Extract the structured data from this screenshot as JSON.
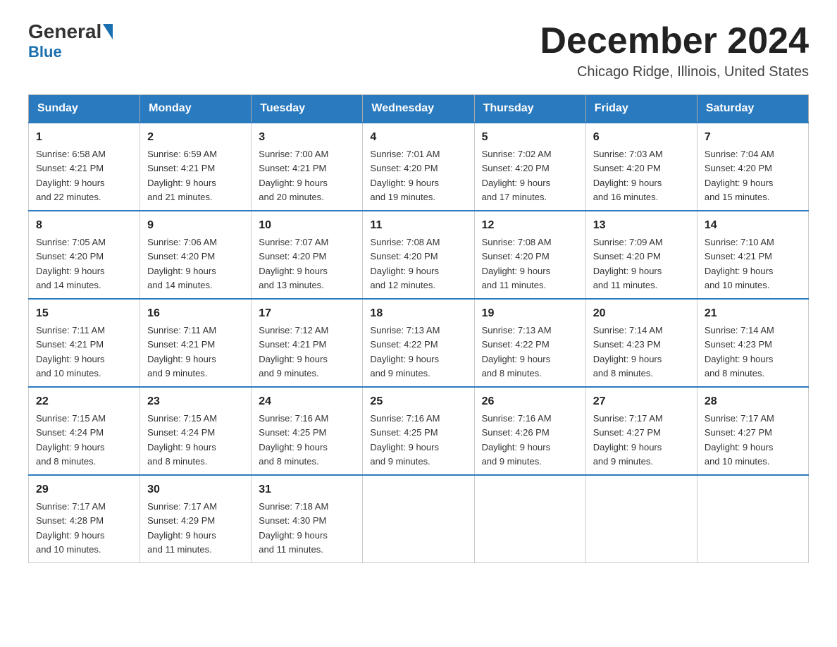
{
  "header": {
    "logo_general": "General",
    "logo_blue": "Blue",
    "title": "December 2024",
    "subtitle": "Chicago Ridge, Illinois, United States"
  },
  "days_of_week": [
    "Sunday",
    "Monday",
    "Tuesday",
    "Wednesday",
    "Thursday",
    "Friday",
    "Saturday"
  ],
  "weeks": [
    [
      {
        "day": "1",
        "sunrise": "6:58 AM",
        "sunset": "4:21 PM",
        "daylight": "9 hours and 22 minutes."
      },
      {
        "day": "2",
        "sunrise": "6:59 AM",
        "sunset": "4:21 PM",
        "daylight": "9 hours and 21 minutes."
      },
      {
        "day": "3",
        "sunrise": "7:00 AM",
        "sunset": "4:21 PM",
        "daylight": "9 hours and 20 minutes."
      },
      {
        "day": "4",
        "sunrise": "7:01 AM",
        "sunset": "4:20 PM",
        "daylight": "9 hours and 19 minutes."
      },
      {
        "day": "5",
        "sunrise": "7:02 AM",
        "sunset": "4:20 PM",
        "daylight": "9 hours and 17 minutes."
      },
      {
        "day": "6",
        "sunrise": "7:03 AM",
        "sunset": "4:20 PM",
        "daylight": "9 hours and 16 minutes."
      },
      {
        "day": "7",
        "sunrise": "7:04 AM",
        "sunset": "4:20 PM",
        "daylight": "9 hours and 15 minutes."
      }
    ],
    [
      {
        "day": "8",
        "sunrise": "7:05 AM",
        "sunset": "4:20 PM",
        "daylight": "9 hours and 14 minutes."
      },
      {
        "day": "9",
        "sunrise": "7:06 AM",
        "sunset": "4:20 PM",
        "daylight": "9 hours and 14 minutes."
      },
      {
        "day": "10",
        "sunrise": "7:07 AM",
        "sunset": "4:20 PM",
        "daylight": "9 hours and 13 minutes."
      },
      {
        "day": "11",
        "sunrise": "7:08 AM",
        "sunset": "4:20 PM",
        "daylight": "9 hours and 12 minutes."
      },
      {
        "day": "12",
        "sunrise": "7:08 AM",
        "sunset": "4:20 PM",
        "daylight": "9 hours and 11 minutes."
      },
      {
        "day": "13",
        "sunrise": "7:09 AM",
        "sunset": "4:20 PM",
        "daylight": "9 hours and 11 minutes."
      },
      {
        "day": "14",
        "sunrise": "7:10 AM",
        "sunset": "4:21 PM",
        "daylight": "9 hours and 10 minutes."
      }
    ],
    [
      {
        "day": "15",
        "sunrise": "7:11 AM",
        "sunset": "4:21 PM",
        "daylight": "9 hours and 10 minutes."
      },
      {
        "day": "16",
        "sunrise": "7:11 AM",
        "sunset": "4:21 PM",
        "daylight": "9 hours and 9 minutes."
      },
      {
        "day": "17",
        "sunrise": "7:12 AM",
        "sunset": "4:21 PM",
        "daylight": "9 hours and 9 minutes."
      },
      {
        "day": "18",
        "sunrise": "7:13 AM",
        "sunset": "4:22 PM",
        "daylight": "9 hours and 9 minutes."
      },
      {
        "day": "19",
        "sunrise": "7:13 AM",
        "sunset": "4:22 PM",
        "daylight": "9 hours and 8 minutes."
      },
      {
        "day": "20",
        "sunrise": "7:14 AM",
        "sunset": "4:23 PM",
        "daylight": "9 hours and 8 minutes."
      },
      {
        "day": "21",
        "sunrise": "7:14 AM",
        "sunset": "4:23 PM",
        "daylight": "9 hours and 8 minutes."
      }
    ],
    [
      {
        "day": "22",
        "sunrise": "7:15 AM",
        "sunset": "4:24 PM",
        "daylight": "9 hours and 8 minutes."
      },
      {
        "day": "23",
        "sunrise": "7:15 AM",
        "sunset": "4:24 PM",
        "daylight": "9 hours and 8 minutes."
      },
      {
        "day": "24",
        "sunrise": "7:16 AM",
        "sunset": "4:25 PM",
        "daylight": "9 hours and 8 minutes."
      },
      {
        "day": "25",
        "sunrise": "7:16 AM",
        "sunset": "4:25 PM",
        "daylight": "9 hours and 9 minutes."
      },
      {
        "day": "26",
        "sunrise": "7:16 AM",
        "sunset": "4:26 PM",
        "daylight": "9 hours and 9 minutes."
      },
      {
        "day": "27",
        "sunrise": "7:17 AM",
        "sunset": "4:27 PM",
        "daylight": "9 hours and 9 minutes."
      },
      {
        "day": "28",
        "sunrise": "7:17 AM",
        "sunset": "4:27 PM",
        "daylight": "9 hours and 10 minutes."
      }
    ],
    [
      {
        "day": "29",
        "sunrise": "7:17 AM",
        "sunset": "4:28 PM",
        "daylight": "9 hours and 10 minutes."
      },
      {
        "day": "30",
        "sunrise": "7:17 AM",
        "sunset": "4:29 PM",
        "daylight": "9 hours and 11 minutes."
      },
      {
        "day": "31",
        "sunrise": "7:18 AM",
        "sunset": "4:30 PM",
        "daylight": "9 hours and 11 minutes."
      },
      null,
      null,
      null,
      null
    ]
  ],
  "labels": {
    "sunrise": "Sunrise:",
    "sunset": "Sunset:",
    "daylight": "Daylight:"
  }
}
